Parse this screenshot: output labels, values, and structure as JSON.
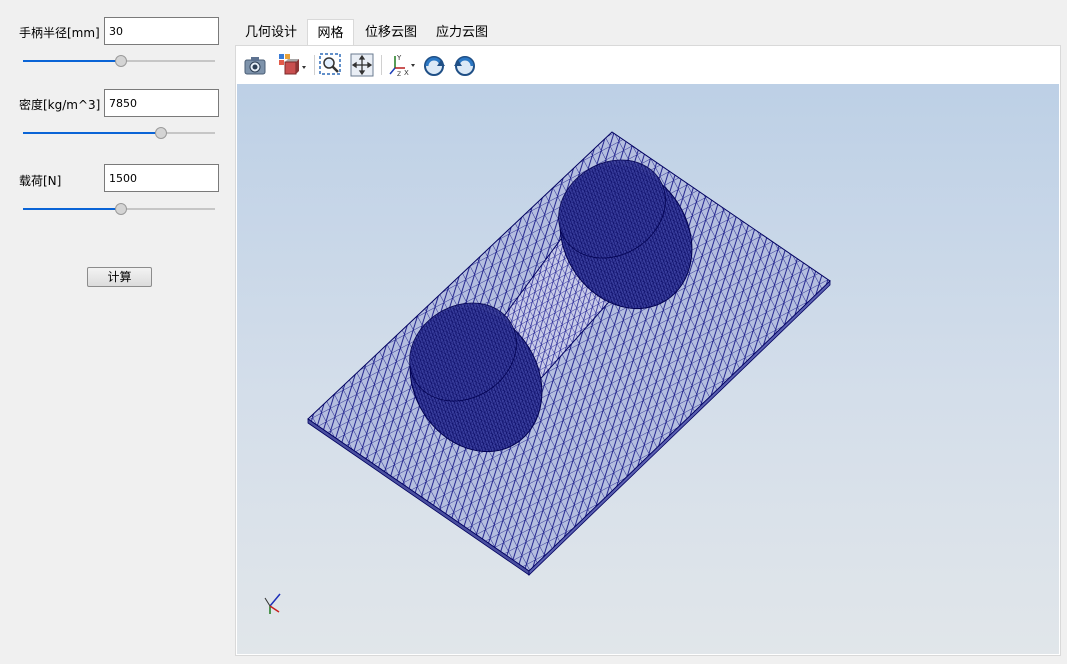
{
  "params": {
    "handle_radius": {
      "label": "手柄半径[mm]",
      "value": "30",
      "slider_fraction": 0.51
    },
    "density": {
      "label": "密度[kg/m^3]",
      "value": "7850",
      "slider_fraction": 0.72
    },
    "load": {
      "label": "载荷[N]",
      "value": "1500",
      "slider_fraction": 0.51
    }
  },
  "calculate_label": "计算",
  "tabs": [
    {
      "label": "几何设计",
      "active": false
    },
    {
      "label": "网格",
      "active": true
    },
    {
      "label": "位移云图",
      "active": false
    },
    {
      "label": "应力云图",
      "active": false
    }
  ],
  "toolbar": [
    {
      "icon": "camera-icon"
    },
    {
      "icon": "view-cube-dropdown-icon"
    },
    {
      "icon": "zoom-box-icon"
    },
    {
      "icon": "fit-all-icon"
    },
    {
      "icon": "axes-dropdown-icon"
    },
    {
      "icon": "rotate-clockwise-icon"
    },
    {
      "icon": "rotate-counterclockwise-icon"
    }
  ],
  "colors": {
    "mesh": "#000080",
    "slider_fill": "#0a64d6"
  }
}
